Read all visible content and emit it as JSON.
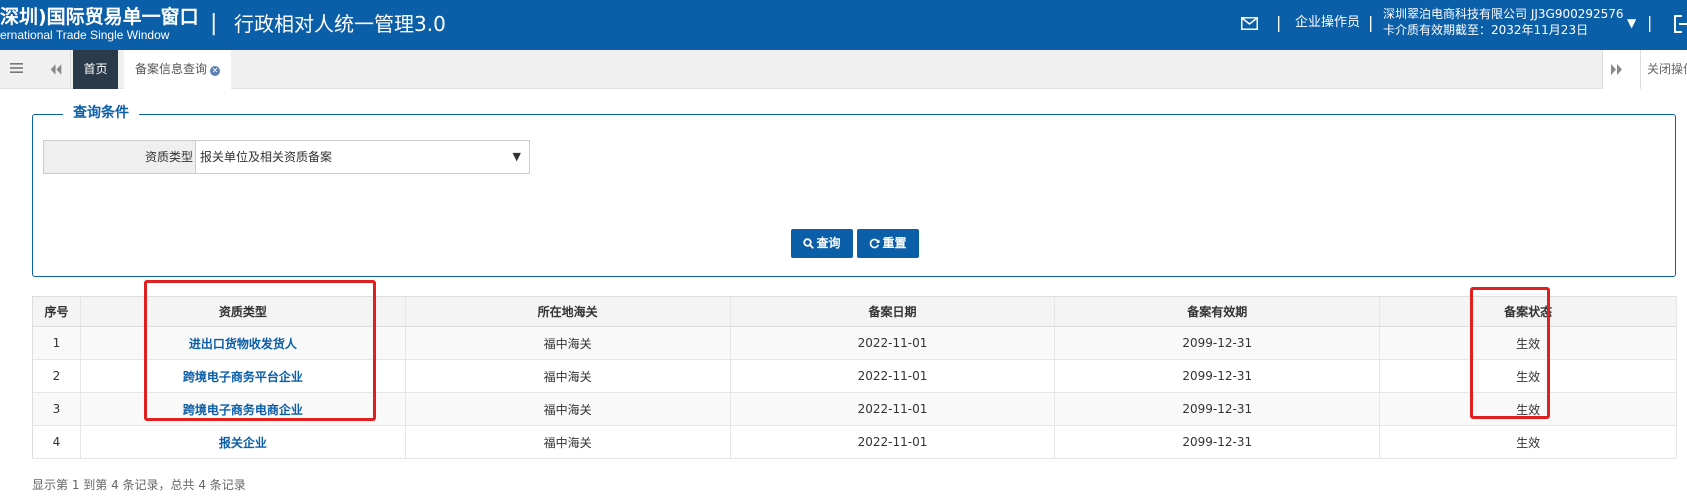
{
  "header": {
    "brand_cn": "深圳)国际贸易单一窗口",
    "brand_en": "ernational Trade Single Window",
    "divider": "|",
    "system_title": "行政相对人统一管理3.0",
    "role": "企业操作员",
    "company_line1": "深圳翠泊电商科技有限公司 JJ3G900292576",
    "company_line2": "卡介质有效期截至：2032年11月23日",
    "separator": "|",
    "caret": "▼"
  },
  "tabs": {
    "home_label": "首页",
    "query_label": "备案信息查询",
    "close_symbol": "✕",
    "close_ops_label": "关闭操作"
  },
  "query": {
    "legend": "查询条件",
    "field_label": "资质类型",
    "field_value": "报关单位及相关资质备案",
    "select_arrow": "▼",
    "search_button": "查询",
    "reset_button": "重置"
  },
  "table": {
    "headers": [
      "序号",
      "资质类型",
      "所在地海关",
      "备案日期",
      "备案有效期",
      "备案状态"
    ],
    "rows": [
      {
        "no": "1",
        "type": "进出口货物收发货人",
        "customs": "福中海关",
        "date": "2022-11-01",
        "valid": "2099-12-31",
        "status": "生效"
      },
      {
        "no": "2",
        "type": "跨境电子商务平台企业",
        "customs": "福中海关",
        "date": "2022-11-01",
        "valid": "2099-12-31",
        "status": "生效"
      },
      {
        "no": "3",
        "type": "跨境电子商务电商企业",
        "customs": "福中海关",
        "date": "2022-11-01",
        "valid": "2099-12-31",
        "status": "生效"
      },
      {
        "no": "4",
        "type": "报关企业",
        "customs": "福中海关",
        "date": "2022-11-01",
        "valid": "2099-12-31",
        "status": "生效"
      }
    ]
  },
  "pager": {
    "summary": "显示第 1 到第 4 条记录，总共 4 条记录"
  },
  "colors": {
    "brand_blue": "#0b5ea8",
    "highlight_red": "#e02020",
    "active_tab": "#2b3a4a"
  }
}
